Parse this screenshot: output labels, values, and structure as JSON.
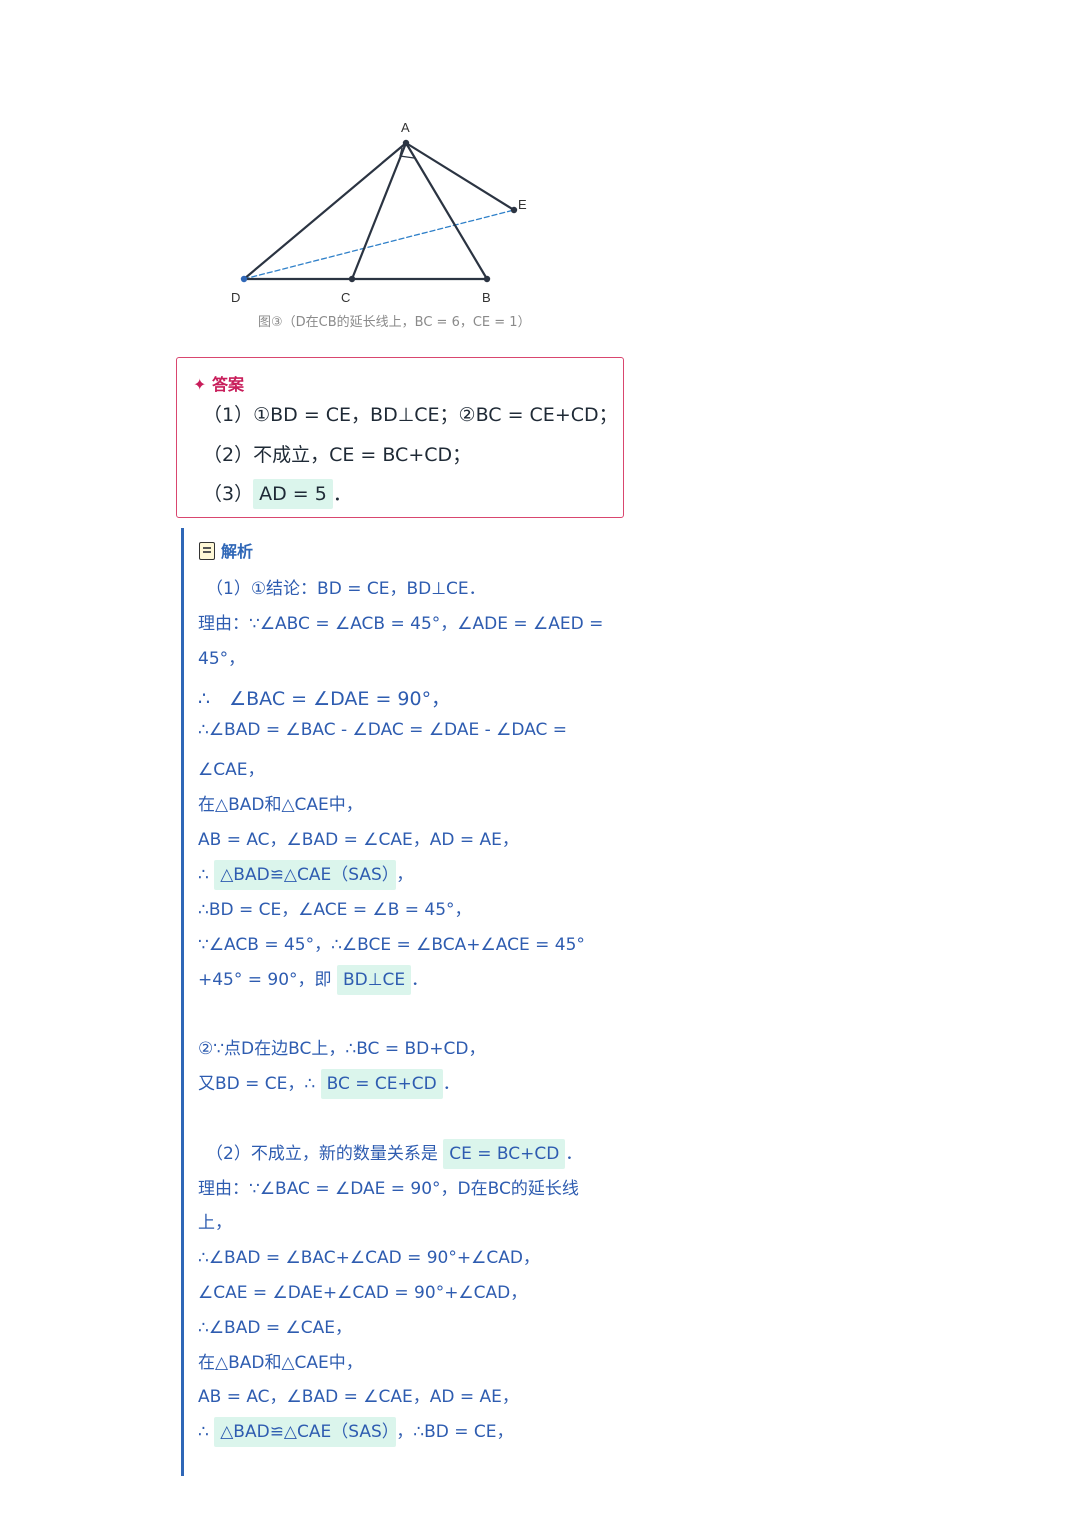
{
  "figure": {
    "labels": {
      "A": "A",
      "B": "B",
      "C": "C",
      "D": "D",
      "E": "E"
    },
    "caption": "图③（D在CB的延长线上，BC = 6，CE = 1）",
    "line_color": "#2b3442",
    "dash_color": "#2f80c9",
    "point_d_color": "#2f67b7"
  },
  "answer": {
    "title": "✦ 答案",
    "lines": [
      "（1）①BD = CE，BD⊥CE；②BC = CE+CD；",
      "（2）不成立，CE = BC+CD；"
    ],
    "line3_prefix": "（3）",
    "line3_highlight": "AD = 5",
    "line3_suffix": "．"
  },
  "analysis": {
    "title": "解析",
    "lines": [
      {
        "pre": "（1）①结论：BD = CE，BD⊥CE．"
      },
      {
        "pre": "理由：∵∠ABC = ∠ACB = 45°，∠ADE = ∠AED ="
      },
      {
        "pre": "45°，"
      },
      {
        "pre": "∴　∠BAC = ∠DAE = 90°，"
      },
      {
        "pre": "∴∠BAD = ∠BAC - ∠DAC = ∠DAE - ∠DAC ="
      },
      {
        "pre": "∠CAE，"
      },
      {
        "pre": "在△BAD和△CAE中，"
      },
      {
        "pre": "AB = AC，∠BAD = ∠CAE，AD = AE，"
      },
      {
        "pre": "∴ ",
        "hl": "△BAD≌△CAE（SAS）",
        "post": "，"
      },
      {
        "pre": "∴BD = CE，∠ACE = ∠B = 45°，"
      },
      {
        "pre": "∵∠ACB = 45°，∴∠BCE = ∠BCA+∠ACE = 45°"
      },
      {
        "pre": "+45° = 90°，即 ",
        "hl": "BD⊥CE",
        "post": "．"
      },
      {
        "pre": "②∵点D在边BC上，∴BC = BD+CD，"
      },
      {
        "pre": "又BD = CE，∴ ",
        "hl": "BC = CE+CD",
        "post": "．"
      },
      {
        "pre": "（2）不成立，新的数量关系是 ",
        "hl": "CE = BC+CD",
        "post": "．"
      },
      {
        "pre": "理由：∵∠BAC = ∠DAE = 90°，D在BC的延长线"
      },
      {
        "pre": "上，"
      },
      {
        "pre": "∴∠BAD = ∠BAC+∠CAD = 90°+∠CAD，"
      },
      {
        "pre": "∠CAE = ∠DAE+∠CAD = 90°+∠CAD，"
      },
      {
        "pre": "∴∠BAD = ∠CAE，"
      },
      {
        "pre": "在△BAD和△CAE中，"
      },
      {
        "pre": "AB = AC，∠BAD = ∠CAE，AD = AE，"
      },
      {
        "pre": "∴ ",
        "hl": "△BAD≌△CAE（SAS）",
        "post": "，∴BD = CE，"
      }
    ]
  }
}
